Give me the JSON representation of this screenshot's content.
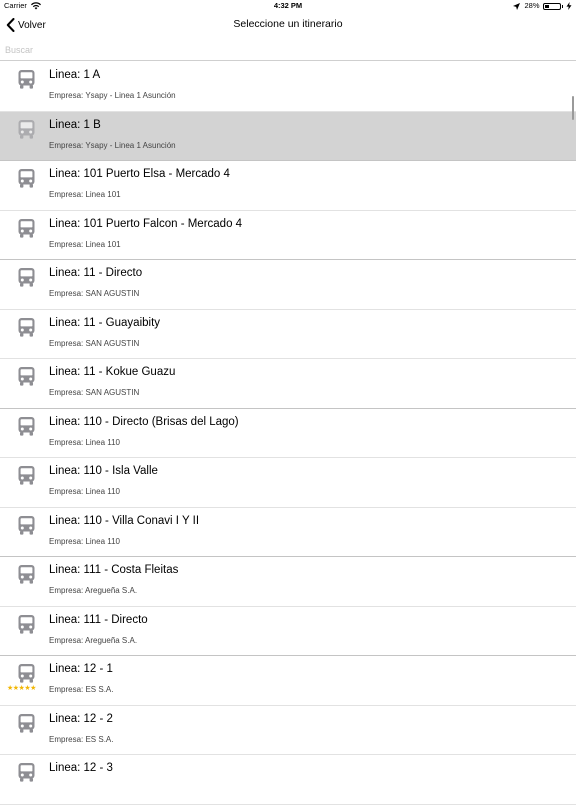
{
  "status_bar": {
    "carrier": "Carrier",
    "time": "4:32 PM",
    "battery_text": "28%",
    "battery_level": 0.28
  },
  "nav": {
    "back_label": "Volver",
    "title": "Seleccione un itinerario"
  },
  "search": {
    "placeholder": "Buscar",
    "value": ""
  },
  "routes": [
    {
      "title": "Linea: 1 A",
      "subtitle": "Empresa: Ysapy - Linea 1 Asunción",
      "selected": false,
      "divider": false,
      "stars": ""
    },
    {
      "title": "Linea: 1 B",
      "subtitle": "Empresa: Ysapy - Linea 1 Asunción",
      "selected": true,
      "divider": true,
      "stars": ""
    },
    {
      "title": "Linea: 101 Puerto Elsa - Mercado 4",
      "subtitle": "Empresa: Linea 101",
      "selected": false,
      "divider": false,
      "stars": ""
    },
    {
      "title": "Linea: 101 Puerto Falcon - Mercado 4",
      "subtitle": "Empresa: Linea 101",
      "selected": false,
      "divider": true,
      "stars": ""
    },
    {
      "title": "Linea: 11 - Directo",
      "subtitle": "Empresa: SAN AGUSTIN",
      "selected": false,
      "divider": false,
      "stars": ""
    },
    {
      "title": "Linea: 11 - Guayaibity",
      "subtitle": "Empresa: SAN AGUSTIN",
      "selected": false,
      "divider": false,
      "stars": ""
    },
    {
      "title": "Linea: 11 - Kokue Guazu",
      "subtitle": "Empresa: SAN AGUSTIN",
      "selected": false,
      "divider": true,
      "stars": ""
    },
    {
      "title": "Linea: 110 - Directo (Brisas del Lago)",
      "subtitle": "Empresa: Linea 110",
      "selected": false,
      "divider": false,
      "stars": ""
    },
    {
      "title": "Linea: 110 - Isla Valle",
      "subtitle": "Empresa: Linea 110",
      "selected": false,
      "divider": false,
      "stars": ""
    },
    {
      "title": "Linea: 110 - Villa Conavi I Y II",
      "subtitle": "Empresa: Linea 110",
      "selected": false,
      "divider": true,
      "stars": ""
    },
    {
      "title": "Linea: 111 - Costa Fleitas",
      "subtitle": "Empresa: Aregueña S.A.",
      "selected": false,
      "divider": false,
      "stars": ""
    },
    {
      "title": "Linea: 111 - Directo",
      "subtitle": "Empresa: Aregueña S.A.",
      "selected": false,
      "divider": true,
      "stars": ""
    },
    {
      "title": "Linea: 12 - 1",
      "subtitle": "Empresa: ES S.A.",
      "selected": false,
      "divider": false,
      "stars": "★★★★★"
    },
    {
      "title": "Linea: 12 - 2",
      "subtitle": "Empresa: ES S.A.",
      "selected": false,
      "divider": false,
      "stars": ""
    },
    {
      "title": "Linea: 12 - 3",
      "subtitle": "",
      "selected": false,
      "divider": false,
      "stars": ""
    }
  ],
  "icons": {
    "row_icon": "bus-icon",
    "back_icon": "chevron-left-icon"
  },
  "colors": {
    "selected_row": "#d3d3d3",
    "icon_gray": "#8e8e93",
    "star": "#f2b705"
  }
}
